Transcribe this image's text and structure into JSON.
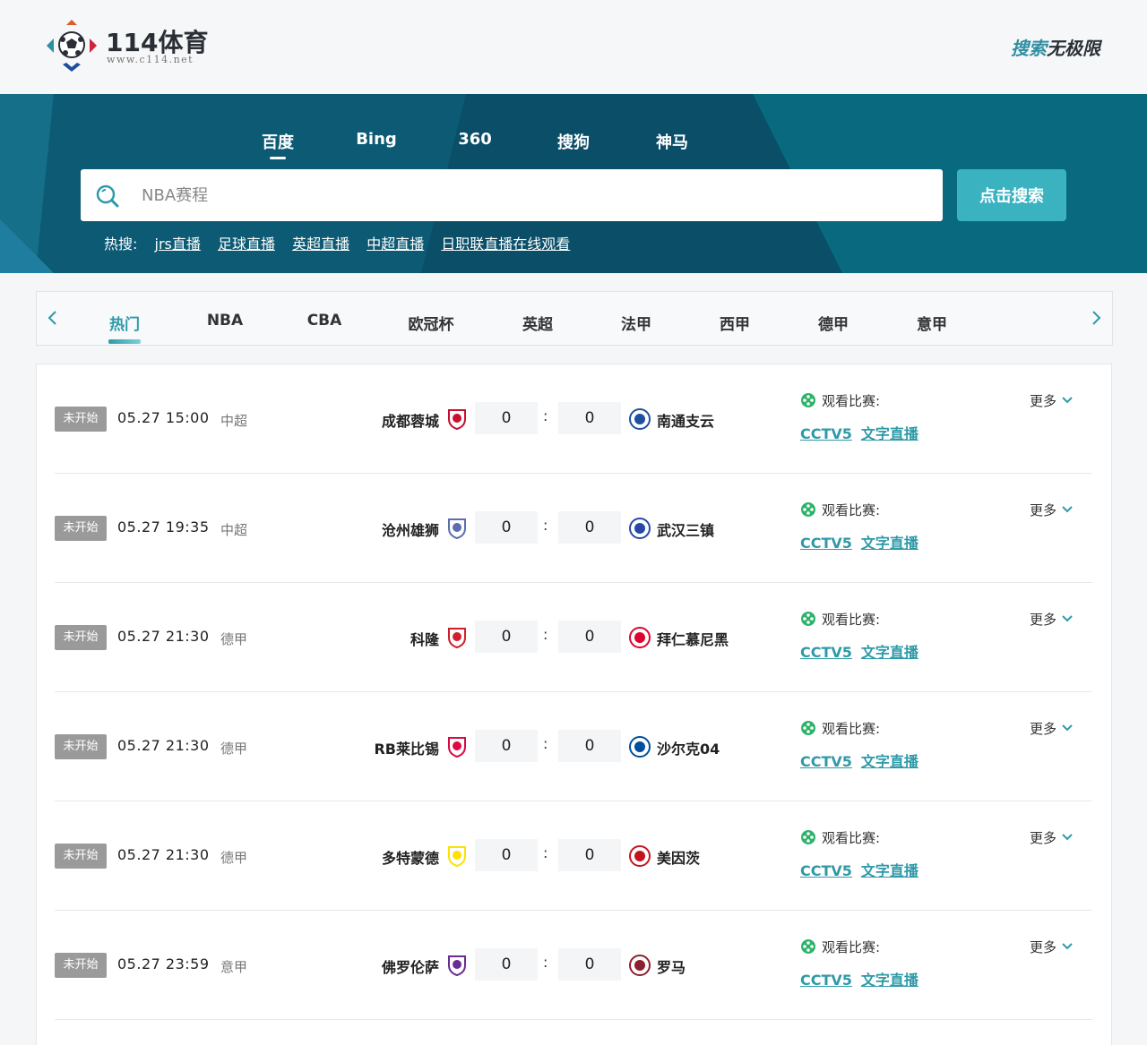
{
  "header": {
    "logo_text": "114体育",
    "logo_sub": "www.c114.net",
    "slogan_a": "搜索",
    "slogan_b": "无极限"
  },
  "search": {
    "engines": [
      {
        "label": "百度",
        "active": true
      },
      {
        "label": "Bing"
      },
      {
        "label": "360"
      },
      {
        "label": "搜狗"
      },
      {
        "label": "神马"
      }
    ],
    "placeholder": "NBA赛程",
    "button": "点击搜索",
    "hot_label": "热搜:",
    "hot_links": [
      "jrs直播",
      "足球直播",
      "英超直播",
      "中超直播",
      "日职联直播在线观看"
    ]
  },
  "tabs": [
    "热门",
    "NBA",
    "CBA",
    "欧冠杯",
    "英超",
    "法甲",
    "西甲",
    "德甲",
    "意甲"
  ],
  "matches": [
    {
      "status": "未开始",
      "time": "05.27 15:00",
      "league": "中超",
      "home": "成都蓉城",
      "away": "南通支云",
      "home_score": "0",
      "away_score": "0",
      "home_color": "#c8102e",
      "away_color": "#1e4fa0"
    },
    {
      "status": "未开始",
      "time": "05.27 19:35",
      "league": "中超",
      "home": "沧州雄狮",
      "away": "武汉三镇",
      "home_score": "0",
      "away_score": "0",
      "home_color": "#5a6fb0",
      "away_color": "#2449a8"
    },
    {
      "status": "未开始",
      "time": "05.27 21:30",
      "league": "德甲",
      "home": "科隆",
      "away": "拜仁慕尼黑",
      "home_score": "0",
      "away_score": "0",
      "home_color": "#d01f2a",
      "away_color": "#dc052d"
    },
    {
      "status": "未开始",
      "time": "05.27 21:30",
      "league": "德甲",
      "home": "RB莱比锡",
      "away": "沙尔克04",
      "home_score": "0",
      "away_score": "0",
      "home_color": "#dd0741",
      "away_color": "#004d9d"
    },
    {
      "status": "未开始",
      "time": "05.27 21:30",
      "league": "德甲",
      "home": "多特蒙德",
      "away": "美因茨",
      "home_score": "0",
      "away_score": "0",
      "home_color": "#fde100",
      "away_color": "#c3141e"
    },
    {
      "status": "未开始",
      "time": "05.27 23:59",
      "league": "意甲",
      "home": "佛罗伦萨",
      "away": "罗马",
      "home_score": "0",
      "away_score": "0",
      "home_color": "#6a2c91",
      "away_color": "#8e1f2f"
    }
  ],
  "watch_label": "观看比赛:",
  "link_cctv": "CCTV5",
  "link_text": "文字直播",
  "more_label": "更多",
  "colors": {
    "accent": "#2e9aa8",
    "banner": "#0b6c80",
    "button": "#3ab2c0"
  }
}
